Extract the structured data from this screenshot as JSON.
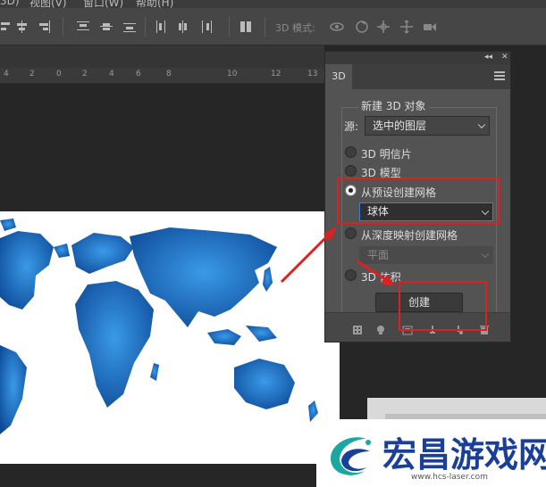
{
  "menu": {
    "items": [
      "3D)",
      "视图(V)",
      "窗口(W)",
      "帮助(H)"
    ]
  },
  "options_bar": {
    "mode_label": "3D 模式:"
  },
  "ruler": {
    "numbers": [
      "4",
      "2",
      "0",
      "2",
      "4",
      "6",
      "8",
      "10",
      "12",
      "13"
    ]
  },
  "panel": {
    "tab_label": "3D",
    "new_3d_object": "新建 3D 对象",
    "source_label": "源:",
    "source_value": "选中的图层",
    "options": [
      {
        "label": "3D 明信片",
        "selected": false
      },
      {
        "label": "3D 模型",
        "selected": false
      },
      {
        "label": "从预设创建网格",
        "selected": true
      },
      {
        "label": "从深度映射创建网格",
        "selected": false
      },
      {
        "label": "3D 体积",
        "selected": false
      }
    ],
    "preset_value": "球体",
    "depth_value": "平面",
    "create_button": "创建"
  },
  "watermark": {
    "title": "宏昌游戏网",
    "url": "www.hcs-laser.com"
  },
  "colors": {
    "accent_red": "#e02020",
    "map_blue": "#1e6fc0",
    "panel_bg": "#535353",
    "brand_blue": "#1a3f97"
  }
}
